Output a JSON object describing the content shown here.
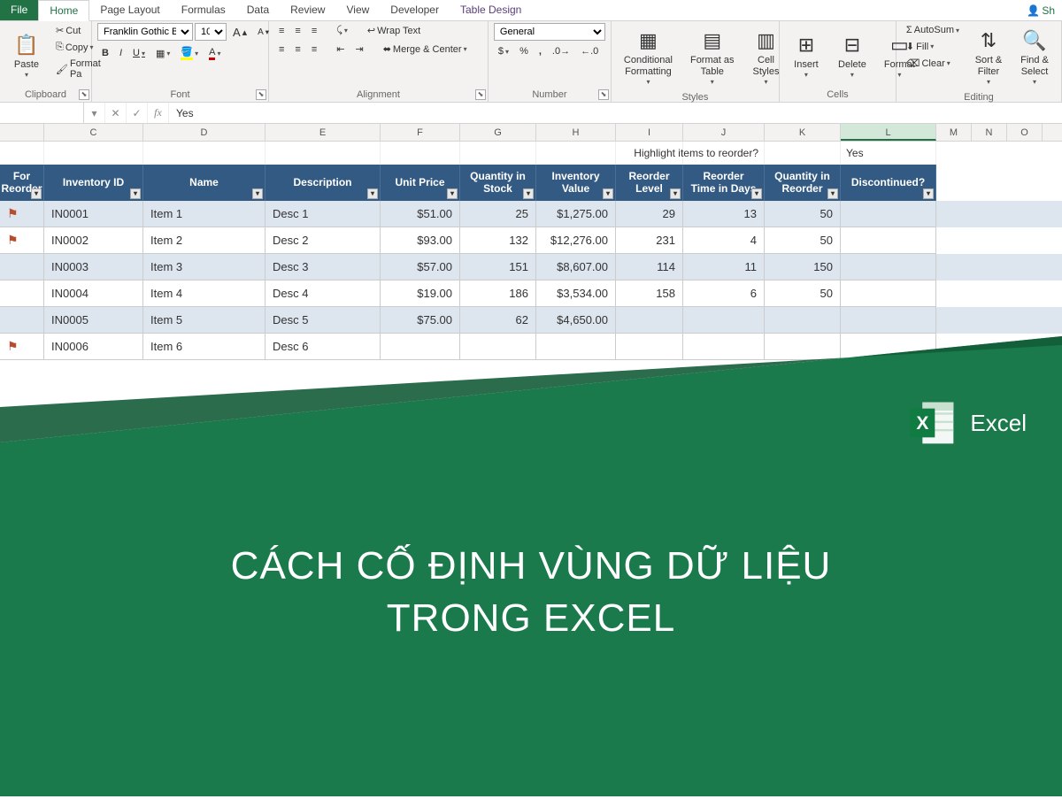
{
  "tabs": {
    "file": "File",
    "home": "Home",
    "pageLayout": "Page Layout",
    "formulas": "Formulas",
    "data": "Data",
    "review": "Review",
    "view": "View",
    "developer": "Developer",
    "tableDesign": "Table Design",
    "share": "Sh"
  },
  "ribbon": {
    "clipboard": {
      "paste": "Paste",
      "cut": "Cut",
      "copy": "Copy",
      "formatPainter": "Format Pa",
      "label": "Clipboard"
    },
    "font": {
      "name": "Franklin Gothic Boo",
      "size": "10",
      "bold": "B",
      "italic": "I",
      "underline": "U",
      "incFont": "A",
      "decFont": "A",
      "label": "Font"
    },
    "alignment": {
      "wrap": "Wrap Text",
      "merge": "Merge & Center",
      "label": "Alignment"
    },
    "number": {
      "format": "General",
      "label": "Number"
    },
    "styles": {
      "cond": "Conditional\nFormatting",
      "fat": "Format as\nTable",
      "cell": "Cell\nStyles",
      "label": "Styles"
    },
    "cells": {
      "insert": "Insert",
      "delete": "Delete",
      "format": "Format",
      "label": "Cells"
    },
    "editing": {
      "autosum": "AutoSum",
      "fill": "Fill",
      "clear": "Clear",
      "sort": "Sort &\nFilter",
      "find": "Find &\nSelect",
      "label": "Editing"
    }
  },
  "formulaBar": {
    "nameBox": "",
    "value": "Yes",
    "fx": "fx"
  },
  "columns": [
    "C",
    "D",
    "E",
    "F",
    "G",
    "H",
    "I",
    "J",
    "K",
    "L",
    "M",
    "N",
    "O"
  ],
  "selectedCol": "L",
  "highlightLabel": "Highlight items to reorder?",
  "highlightValue": "Yes",
  "headers": {
    "reorder": "For\nReorder",
    "id": "Inventory ID",
    "name": "Name",
    "desc": "Description",
    "price": "Unit Price",
    "qty": "Quantity in\nStock",
    "val": "Inventory\nValue",
    "lvl": "Reorder\nLevel",
    "days": "Reorder\nTime in Days",
    "qre": "Quantity in\nReorder",
    "disc": "Discontinued?"
  },
  "rows": [
    {
      "flag": true,
      "id": "IN0001",
      "name": "Item 1",
      "desc": "Desc 1",
      "price": "$51.00",
      "qty": "25",
      "val": "$1,275.00",
      "lvl": "29",
      "days": "13",
      "qre": "50",
      "band": true
    },
    {
      "flag": true,
      "id": "IN0002",
      "name": "Item 2",
      "desc": "Desc 2",
      "price": "$93.00",
      "qty": "132",
      "val": "$12,276.00",
      "lvl": "231",
      "days": "4",
      "qre": "50",
      "band": false
    },
    {
      "flag": false,
      "id": "IN0003",
      "name": "Item 3",
      "desc": "Desc 3",
      "price": "$57.00",
      "qty": "151",
      "val": "$8,607.00",
      "lvl": "114",
      "days": "11",
      "qre": "150",
      "band": true
    },
    {
      "flag": false,
      "id": "IN0004",
      "name": "Item 4",
      "desc": "Desc 4",
      "price": "$19.00",
      "qty": "186",
      "val": "$3,534.00",
      "lvl": "158",
      "days": "6",
      "qre": "50",
      "band": false
    },
    {
      "flag": false,
      "id": "IN0005",
      "name": "Item 5",
      "desc": "Desc 5",
      "price": "$75.00",
      "qty": "62",
      "val": "$4,650.00",
      "lvl": "",
      "days": "",
      "qre": "",
      "band": true
    },
    {
      "flag": true,
      "id": "IN0006",
      "name": "Item 6",
      "desc": "Desc 6",
      "price": "",
      "qty": "",
      "val": "",
      "lvl": "",
      "days": "",
      "qre": "",
      "band": false
    }
  ],
  "overlay": {
    "app": "Excel",
    "title": "CÁCH CỐ ĐỊNH VÙNG DỮ LIỆU\nTRONG EXCEL"
  }
}
